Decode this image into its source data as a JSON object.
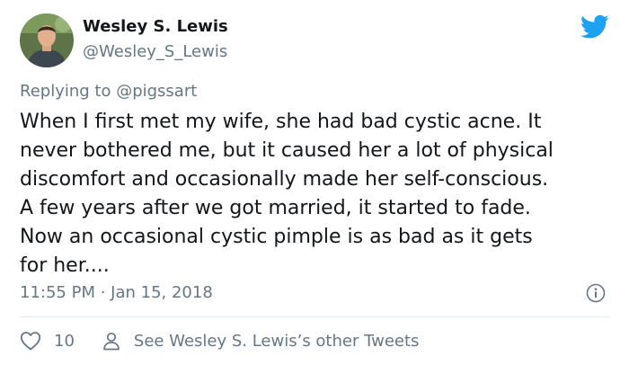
{
  "author": {
    "name": "Wesley S. Lewis",
    "handle": "@Wesley_S_Lewis"
  },
  "reply": {
    "prefix": "Replying to ",
    "mention": "@pigssart"
  },
  "tweet": {
    "text": "When I first met my wife, she had bad cystic acne. It\nnever bothered me, but it caused her a lot of physical\ndiscomfort and occasionally made her self-conscious.\nA few years after we got married, it started to fade.\nNow an occasional cystic pimple is as bad as it gets\nfor her....",
    "timestamp": "11:55 PM · Jan 15, 2018"
  },
  "actions": {
    "like_count": "10",
    "other_tweets_label": "See Wesley S. Lewis’s other Tweets"
  },
  "icons": {
    "brand": "twitter-bird-icon",
    "info": "info-icon",
    "like": "heart-icon",
    "profile": "person-icon"
  },
  "colors": {
    "twitter_blue": "#1da1f2",
    "text": "#14171a",
    "secondary": "#657786",
    "divider": "#e1e8ed"
  }
}
